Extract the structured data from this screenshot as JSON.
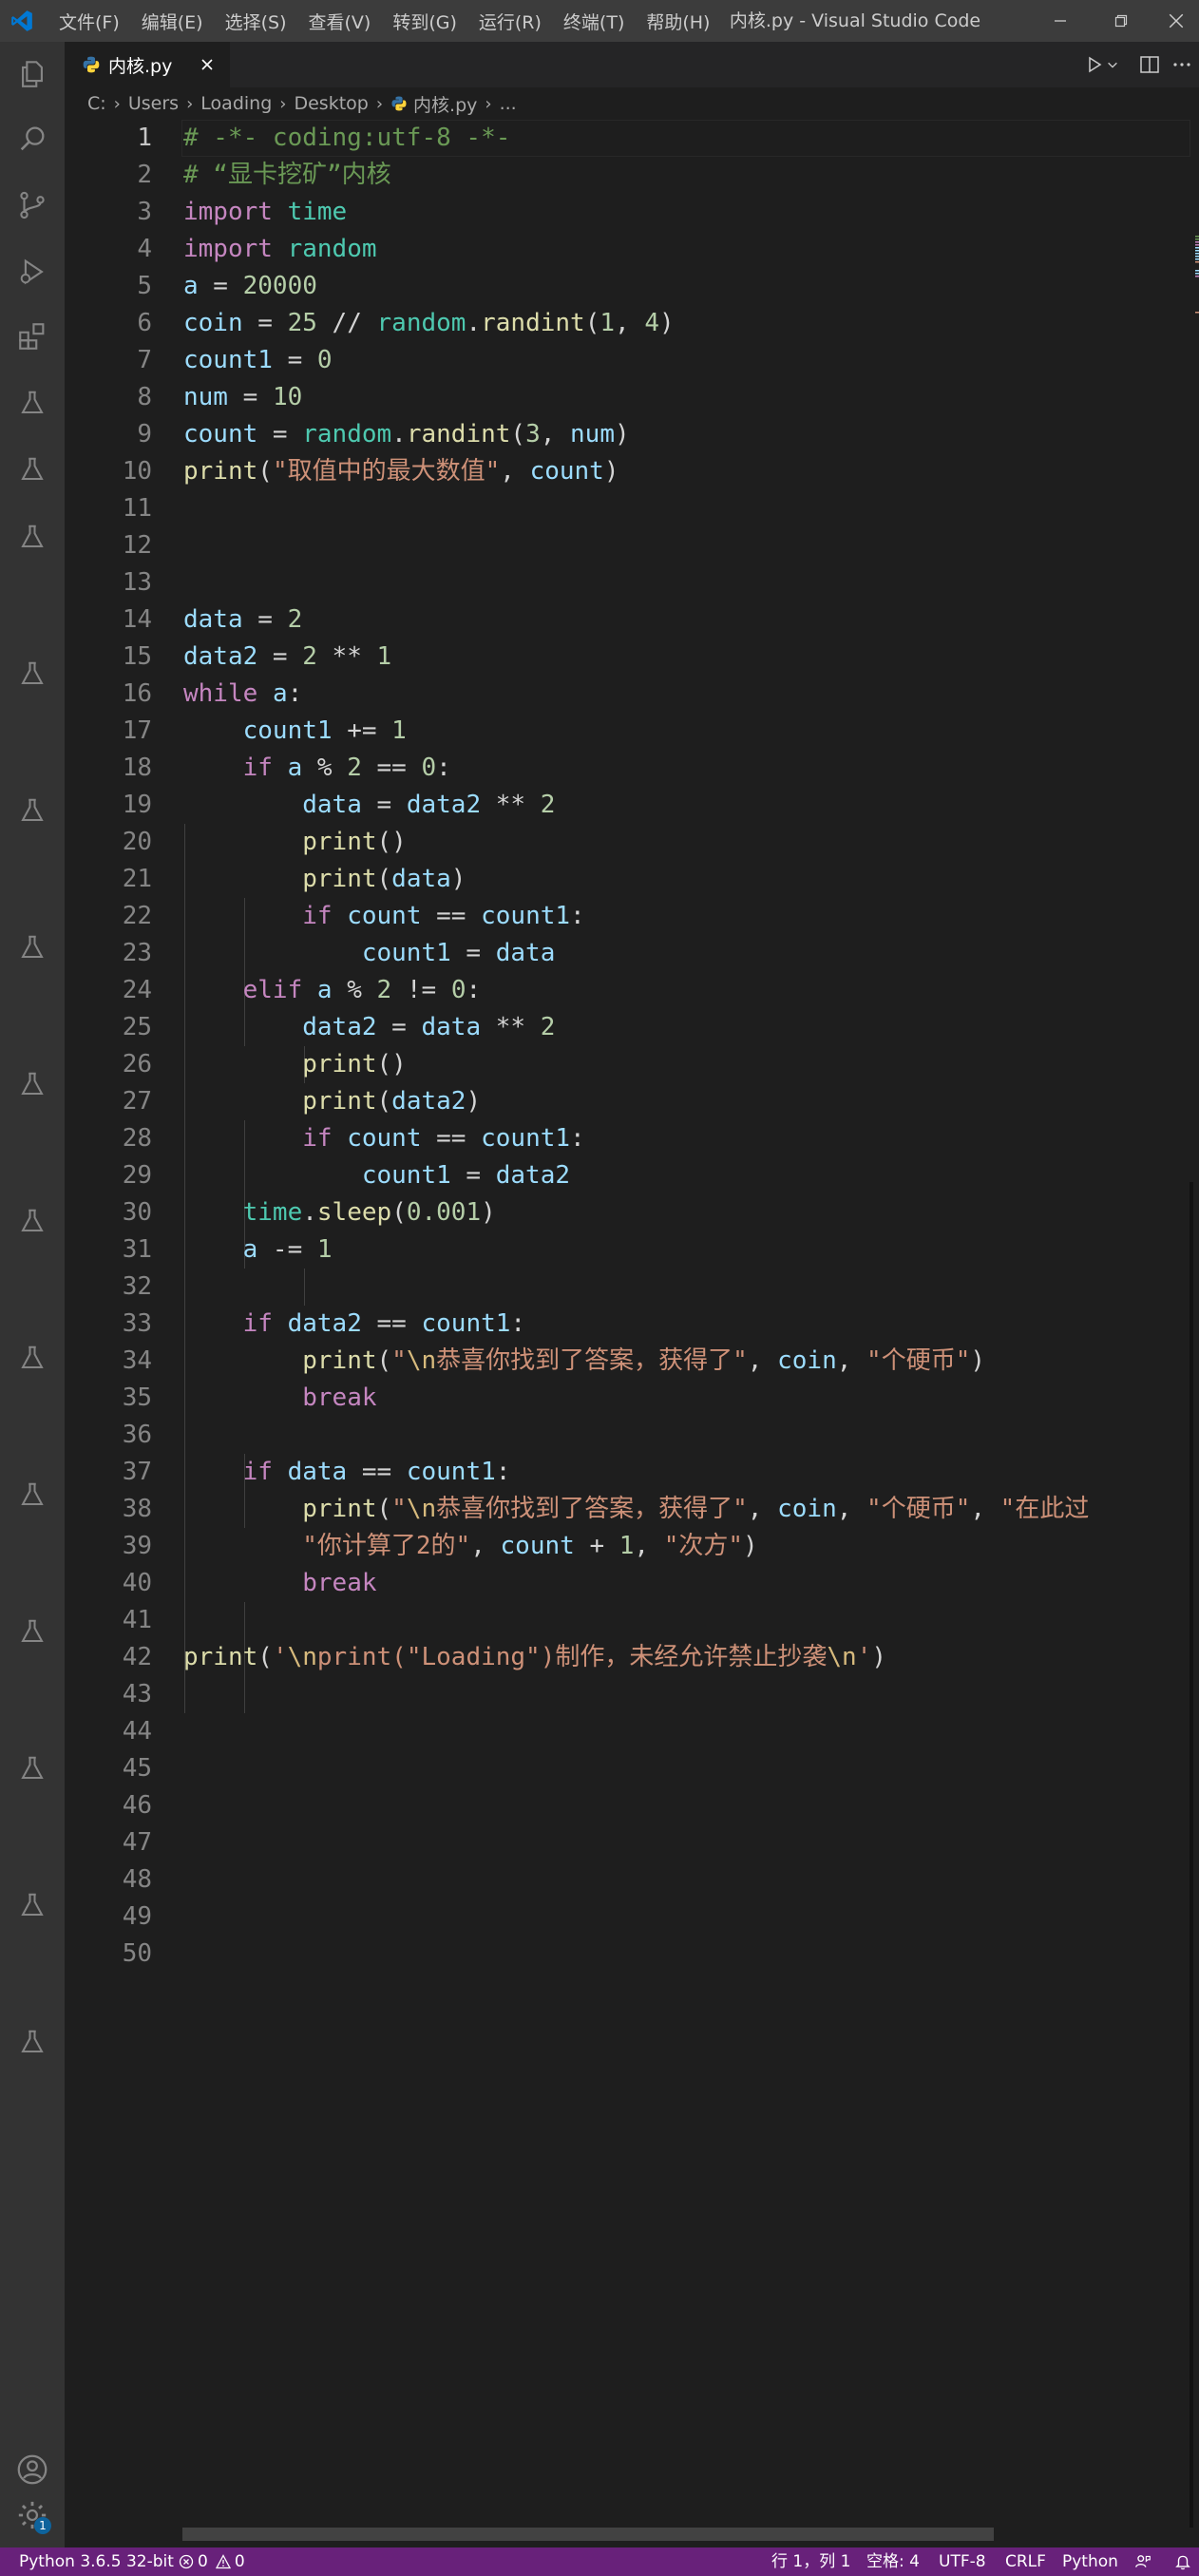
{
  "window": {
    "title": "内核.py - Visual Studio Code",
    "menu": [
      "文件(F)",
      "编辑(E)",
      "选择(S)",
      "查看(V)",
      "转到(G)",
      "运行(R)",
      "终端(T)",
      "帮助(H)"
    ]
  },
  "tab": {
    "filename": "内核.py"
  },
  "breadcrumb": [
    "C:",
    "Users",
    "Loading",
    "Desktop",
    "内核.py",
    "..."
  ],
  "editor": {
    "current_line": 1,
    "line_numbers": [
      "1",
      "2",
      "3",
      "4",
      "5",
      "6",
      "7",
      "8",
      "9",
      "10",
      "11",
      "12",
      "13",
      "14",
      "15",
      "16",
      "17",
      "18",
      "19",
      "20",
      "21",
      "22",
      "23",
      "24",
      "25",
      "26",
      "27",
      "28",
      "29",
      "30",
      "31",
      "32",
      "33",
      "34",
      "35",
      "36",
      "37",
      "38",
      "39",
      "40",
      "41",
      "42",
      "43",
      "44",
      "45",
      "46",
      "47",
      "48",
      "49",
      "50"
    ],
    "lines": [
      [
        [
          "c-com",
          "# -*- coding:utf-8 -*-"
        ]
      ],
      [
        [
          "c-com",
          "# “显卡挖矿”内核"
        ]
      ],
      [
        [
          "c-kw",
          "import"
        ],
        [
          "c-op",
          " "
        ],
        [
          "c-mod",
          "time"
        ]
      ],
      [
        [
          "c-kw",
          "import"
        ],
        [
          "c-op",
          " "
        ],
        [
          "c-mod",
          "random"
        ]
      ],
      [
        [
          "c-var",
          "a"
        ],
        [
          "c-op",
          " = "
        ],
        [
          "c-num",
          "20000"
        ]
      ],
      [
        [
          "c-var",
          "coin"
        ],
        [
          "c-op",
          " = "
        ],
        [
          "c-num",
          "25"
        ],
        [
          "c-op",
          " // "
        ],
        [
          "c-mod",
          "random"
        ],
        [
          "c-op",
          "."
        ],
        [
          "c-fn",
          "randint"
        ],
        [
          "c-op",
          "("
        ],
        [
          "c-num",
          "1"
        ],
        [
          "c-op",
          ", "
        ],
        [
          "c-num",
          "4"
        ],
        [
          "c-op",
          ")"
        ]
      ],
      [
        [
          "c-var",
          "count1"
        ],
        [
          "c-op",
          " = "
        ],
        [
          "c-num",
          "0"
        ]
      ],
      [
        [
          "c-var",
          "num"
        ],
        [
          "c-op",
          " = "
        ],
        [
          "c-num",
          "10"
        ]
      ],
      [
        [
          "c-var",
          "count"
        ],
        [
          "c-op",
          " = "
        ],
        [
          "c-mod",
          "random"
        ],
        [
          "c-op",
          "."
        ],
        [
          "c-fn",
          "randint"
        ],
        [
          "c-op",
          "("
        ],
        [
          "c-num",
          "3"
        ],
        [
          "c-op",
          ", "
        ],
        [
          "c-var",
          "num"
        ],
        [
          "c-op",
          ")"
        ]
      ],
      [
        [
          "c-fn",
          "print"
        ],
        [
          "c-op",
          "("
        ],
        [
          "c-str",
          "\"取值中的最大数值\""
        ],
        [
          "c-op",
          ", "
        ],
        [
          "c-var",
          "count"
        ],
        [
          "c-op",
          ")"
        ]
      ],
      [],
      [],
      [],
      [
        [
          "c-var",
          "data"
        ],
        [
          "c-op",
          " = "
        ],
        [
          "c-num",
          "2"
        ]
      ],
      [
        [
          "c-var",
          "data2"
        ],
        [
          "c-op",
          " = "
        ],
        [
          "c-num",
          "2"
        ],
        [
          "c-op",
          " ** "
        ],
        [
          "c-num",
          "1"
        ]
      ],
      [
        [
          "c-kw",
          "while"
        ],
        [
          "c-op",
          " "
        ],
        [
          "c-var",
          "a"
        ],
        [
          "c-op",
          ":"
        ]
      ],
      [
        [
          "c-op",
          "    "
        ],
        [
          "c-var",
          "count1"
        ],
        [
          "c-op",
          " += "
        ],
        [
          "c-num",
          "1"
        ]
      ],
      [
        [
          "c-op",
          "    "
        ],
        [
          "c-kw",
          "if"
        ],
        [
          "c-op",
          " "
        ],
        [
          "c-var",
          "a"
        ],
        [
          "c-op",
          " % "
        ],
        [
          "c-num",
          "2"
        ],
        [
          "c-op",
          " == "
        ],
        [
          "c-num",
          "0"
        ],
        [
          "c-op",
          ":"
        ]
      ],
      [
        [
          "c-op",
          "        "
        ],
        [
          "c-var",
          "data"
        ],
        [
          "c-op",
          " = "
        ],
        [
          "c-var",
          "data2"
        ],
        [
          "c-op",
          " ** "
        ],
        [
          "c-num",
          "2"
        ]
      ],
      [
        [
          "c-op",
          "        "
        ],
        [
          "c-fn",
          "print"
        ],
        [
          "c-op",
          "()"
        ]
      ],
      [
        [
          "c-op",
          "        "
        ],
        [
          "c-fn",
          "print"
        ],
        [
          "c-op",
          "("
        ],
        [
          "c-var",
          "data"
        ],
        [
          "c-op",
          ")"
        ]
      ],
      [
        [
          "c-op",
          "        "
        ],
        [
          "c-kw",
          "if"
        ],
        [
          "c-op",
          " "
        ],
        [
          "c-var",
          "count"
        ],
        [
          "c-op",
          " == "
        ],
        [
          "c-var",
          "count1"
        ],
        [
          "c-op",
          ":"
        ]
      ],
      [
        [
          "c-op",
          "            "
        ],
        [
          "c-var",
          "count1"
        ],
        [
          "c-op",
          " = "
        ],
        [
          "c-var",
          "data"
        ]
      ],
      [
        [
          "c-op",
          "    "
        ],
        [
          "c-kw",
          "elif"
        ],
        [
          "c-op",
          " "
        ],
        [
          "c-var",
          "a"
        ],
        [
          "c-op",
          " % "
        ],
        [
          "c-num",
          "2"
        ],
        [
          "c-op",
          " != "
        ],
        [
          "c-num",
          "0"
        ],
        [
          "c-op",
          ":"
        ]
      ],
      [
        [
          "c-op",
          "        "
        ],
        [
          "c-var",
          "data2"
        ],
        [
          "c-op",
          " = "
        ],
        [
          "c-var",
          "data"
        ],
        [
          "c-op",
          " ** "
        ],
        [
          "c-num",
          "2"
        ]
      ],
      [
        [
          "c-op",
          "        "
        ],
        [
          "c-fn",
          "print"
        ],
        [
          "c-op",
          "()"
        ]
      ],
      [
        [
          "c-op",
          "        "
        ],
        [
          "c-fn",
          "print"
        ],
        [
          "c-op",
          "("
        ],
        [
          "c-var",
          "data2"
        ],
        [
          "c-op",
          ")"
        ]
      ],
      [
        [
          "c-op",
          "        "
        ],
        [
          "c-kw",
          "if"
        ],
        [
          "c-op",
          " "
        ],
        [
          "c-var",
          "count"
        ],
        [
          "c-op",
          " == "
        ],
        [
          "c-var",
          "count1"
        ],
        [
          "c-op",
          ":"
        ]
      ],
      [
        [
          "c-op",
          "            "
        ],
        [
          "c-var",
          "count1"
        ],
        [
          "c-op",
          " = "
        ],
        [
          "c-var",
          "data2"
        ]
      ],
      [
        [
          "c-op",
          "    "
        ],
        [
          "c-mod",
          "time"
        ],
        [
          "c-op",
          "."
        ],
        [
          "c-fn",
          "sleep"
        ],
        [
          "c-op",
          "("
        ],
        [
          "c-num",
          "0.001"
        ],
        [
          "c-op",
          ")"
        ]
      ],
      [
        [
          "c-op",
          "    "
        ],
        [
          "c-var",
          "a"
        ],
        [
          "c-op",
          " -= "
        ],
        [
          "c-num",
          "1"
        ]
      ],
      [],
      [
        [
          "c-op",
          "    "
        ],
        [
          "c-kw",
          "if"
        ],
        [
          "c-op",
          " "
        ],
        [
          "c-var",
          "data2"
        ],
        [
          "c-op",
          " == "
        ],
        [
          "c-var",
          "count1"
        ],
        [
          "c-op",
          ":"
        ]
      ],
      [
        [
          "c-op",
          "        "
        ],
        [
          "c-fn",
          "print"
        ],
        [
          "c-op",
          "("
        ],
        [
          "c-str",
          "\""
        ],
        [
          "c-esc",
          "\\n"
        ],
        [
          "c-str",
          "恭喜你找到了答案，获得了\""
        ],
        [
          "c-op",
          ", "
        ],
        [
          "c-var",
          "coin"
        ],
        [
          "c-op",
          ", "
        ],
        [
          "c-str",
          "\"个硬币\""
        ],
        [
          "c-op",
          ")"
        ]
      ],
      [
        [
          "c-op",
          "        "
        ],
        [
          "c-kw",
          "break"
        ]
      ],
      [],
      [
        [
          "c-op",
          "    "
        ],
        [
          "c-kw",
          "if"
        ],
        [
          "c-op",
          " "
        ],
        [
          "c-var",
          "data"
        ],
        [
          "c-op",
          " == "
        ],
        [
          "c-var",
          "count1"
        ],
        [
          "c-op",
          ":"
        ]
      ],
      [
        [
          "c-op",
          "        "
        ],
        [
          "c-fn",
          "print"
        ],
        [
          "c-op",
          "("
        ],
        [
          "c-str",
          "\""
        ],
        [
          "c-esc",
          "\\n"
        ],
        [
          "c-str",
          "恭喜你找到了答案，获得了\""
        ],
        [
          "c-op",
          ", "
        ],
        [
          "c-var",
          "coin"
        ],
        [
          "c-op",
          ", "
        ],
        [
          "c-str",
          "\"个硬币\""
        ],
        [
          "c-op",
          ", "
        ],
        [
          "c-str",
          "\"在此过"
        ]
      ],
      [
        [
          "c-op",
          "        "
        ],
        [
          "c-str",
          "\"你计算了2的\""
        ],
        [
          "c-op",
          ", "
        ],
        [
          "c-var",
          "count"
        ],
        [
          "c-op",
          " + "
        ],
        [
          "c-num",
          "1"
        ],
        [
          "c-op",
          ", "
        ],
        [
          "c-str",
          "\"次方\""
        ],
        [
          "c-op",
          ")"
        ]
      ],
      [
        [
          "c-op",
          "        "
        ],
        [
          "c-kw",
          "break"
        ]
      ],
      [],
      [
        [
          "c-fn",
          "print"
        ],
        [
          "c-op",
          "("
        ],
        [
          "c-str",
          "'"
        ],
        [
          "c-esc",
          "\\n"
        ],
        [
          "c-str",
          "print(\"Loading\")制作，未经允许禁止抄袭"
        ],
        [
          "c-esc",
          "\\n"
        ],
        [
          "c-str",
          "'"
        ],
        [
          "c-op",
          ")"
        ]
      ],
      [],
      [],
      [],
      [],
      [],
      [],
      [],
      []
    ]
  },
  "statusbar": {
    "interpreter": "Python 3.6.5 32-bit",
    "errors": "0",
    "warnings": "0",
    "position": "行 1，列 1",
    "spaces": "空格: 4",
    "encoding": "UTF-8",
    "eol": "CRLF",
    "language": "Python",
    "accounts_badge": "1"
  },
  "colors": {
    "statusbar": "#68217a",
    "activitybar": "#333333",
    "editor_bg": "#1e1e1e",
    "vscode_blue": "#0078d4"
  }
}
